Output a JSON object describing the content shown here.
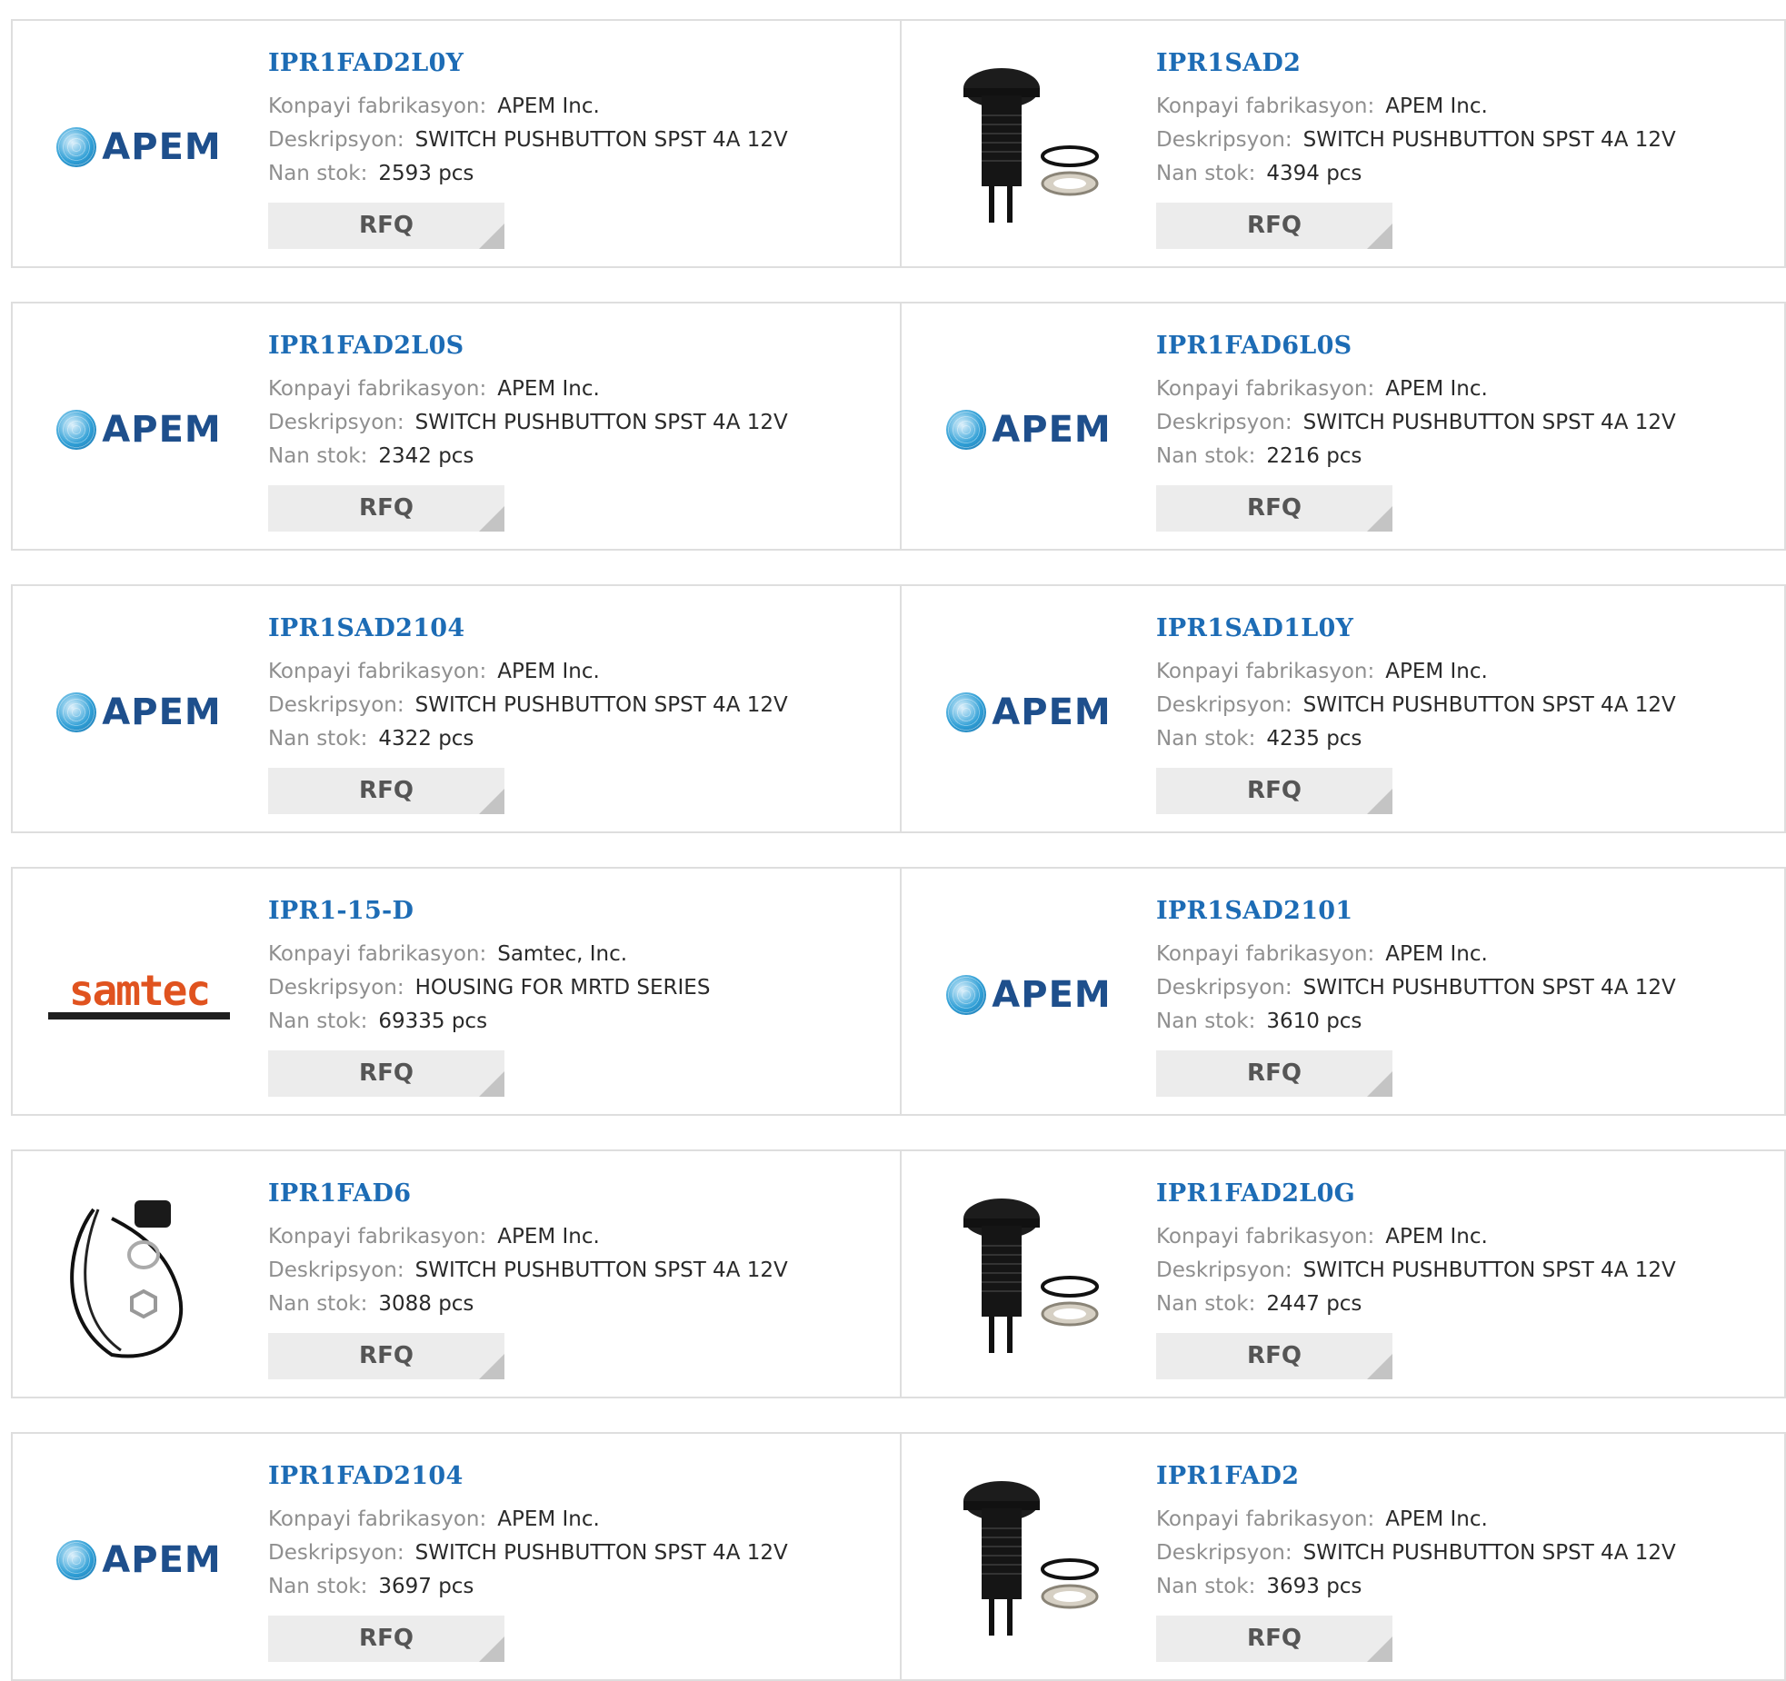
{
  "labels": {
    "manufacturer": "Konpayi fabrikasyon:",
    "description": "Deskripsyon:",
    "stock": "Nan stok:",
    "rfq": "RFQ"
  },
  "products": [
    {
      "part": "IPR1FAD2L0Y",
      "manufacturer": "APEM Inc.",
      "description": "SWITCH PUSHBUTTON SPST 4A 12V",
      "stock": "2593 pcs",
      "image": "apem-logo"
    },
    {
      "part": "IPR1SAD2",
      "manufacturer": "APEM Inc.",
      "description": "SWITCH PUSHBUTTON SPST 4A 12V",
      "stock": "4394 pcs",
      "image": "pushbutton-photo"
    },
    {
      "part": "IPR1FAD2L0S",
      "manufacturer": "APEM Inc.",
      "description": "SWITCH PUSHBUTTON SPST 4A 12V",
      "stock": "2342 pcs",
      "image": "apem-logo"
    },
    {
      "part": "IPR1FAD6L0S",
      "manufacturer": "APEM Inc.",
      "description": "SWITCH PUSHBUTTON SPST 4A 12V",
      "stock": "2216 pcs",
      "image": "apem-logo"
    },
    {
      "part": "IPR1SAD2104",
      "manufacturer": "APEM Inc.",
      "description": "SWITCH PUSHBUTTON SPST 4A 12V",
      "stock": "4322 pcs",
      "image": "apem-logo"
    },
    {
      "part": "IPR1SAD1L0Y",
      "manufacturer": "APEM Inc.",
      "description": "SWITCH PUSHBUTTON SPST 4A 12V",
      "stock": "4235 pcs",
      "image": "apem-logo"
    },
    {
      "part": "IPR1-15-D",
      "manufacturer": "Samtec, Inc.",
      "description": "HOUSING FOR MRTD SERIES",
      "stock": "69335 pcs",
      "image": "samtec-logo"
    },
    {
      "part": "IPR1SAD2101",
      "manufacturer": "APEM Inc.",
      "description": "SWITCH PUSHBUTTON SPST 4A 12V",
      "stock": "3610 pcs",
      "image": "apem-logo"
    },
    {
      "part": "IPR1FAD6",
      "manufacturer": "APEM Inc.",
      "description": "SWITCH PUSHBUTTON SPST 4A 12V",
      "stock": "3088 pcs",
      "image": "wired-switch-photo"
    },
    {
      "part": "IPR1FAD2L0G",
      "manufacturer": "APEM Inc.",
      "description": "SWITCH PUSHBUTTON SPST 4A 12V",
      "stock": "2447 pcs",
      "image": "pushbutton-photo"
    },
    {
      "part": "IPR1FAD2104",
      "manufacturer": "APEM Inc.",
      "description": "SWITCH PUSHBUTTON SPST 4A 12V",
      "stock": "3697 pcs",
      "image": "apem-logo"
    },
    {
      "part": "IPR1FAD2",
      "manufacturer": "APEM Inc.",
      "description": "SWITCH PUSHBUTTON SPST 4A 12V",
      "stock": "3693 pcs",
      "image": "pushbutton-photo"
    }
  ],
  "logos": {
    "apem": "APEM",
    "samtec": "samtec"
  },
  "colors": {
    "part_link": "#1d6cb5",
    "label": "#8f8f8f",
    "value": "#2a2a2a",
    "rfq_bg": "#ececec",
    "border": "#dedede"
  }
}
